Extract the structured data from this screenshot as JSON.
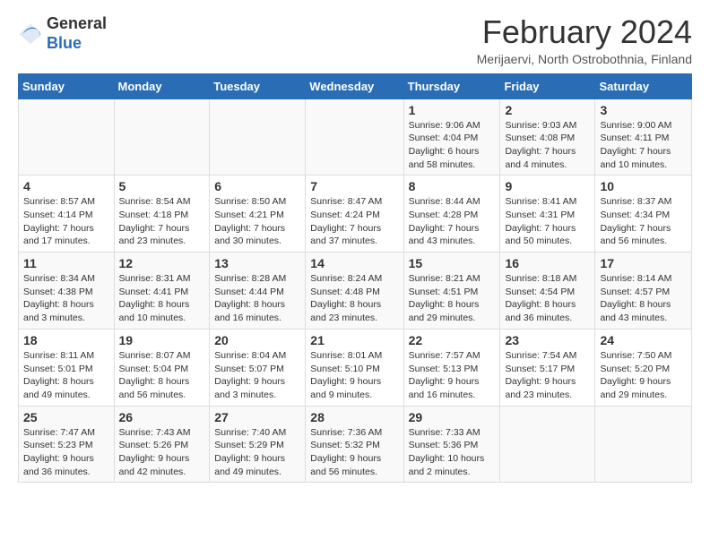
{
  "header": {
    "logo_general": "General",
    "logo_blue": "Blue",
    "month_title": "February 2024",
    "location": "Merijaervi, North Ostrobothnia, Finland"
  },
  "weekdays": [
    "Sunday",
    "Monday",
    "Tuesday",
    "Wednesday",
    "Thursday",
    "Friday",
    "Saturday"
  ],
  "weeks": [
    [
      {
        "day": "",
        "info": ""
      },
      {
        "day": "",
        "info": ""
      },
      {
        "day": "",
        "info": ""
      },
      {
        "day": "",
        "info": ""
      },
      {
        "day": "1",
        "info": "Sunrise: 9:06 AM\nSunset: 4:04 PM\nDaylight: 6 hours\nand 58 minutes."
      },
      {
        "day": "2",
        "info": "Sunrise: 9:03 AM\nSunset: 4:08 PM\nDaylight: 7 hours\nand 4 minutes."
      },
      {
        "day": "3",
        "info": "Sunrise: 9:00 AM\nSunset: 4:11 PM\nDaylight: 7 hours\nand 10 minutes."
      }
    ],
    [
      {
        "day": "4",
        "info": "Sunrise: 8:57 AM\nSunset: 4:14 PM\nDaylight: 7 hours\nand 17 minutes."
      },
      {
        "day": "5",
        "info": "Sunrise: 8:54 AM\nSunset: 4:18 PM\nDaylight: 7 hours\nand 23 minutes."
      },
      {
        "day": "6",
        "info": "Sunrise: 8:50 AM\nSunset: 4:21 PM\nDaylight: 7 hours\nand 30 minutes."
      },
      {
        "day": "7",
        "info": "Sunrise: 8:47 AM\nSunset: 4:24 PM\nDaylight: 7 hours\nand 37 minutes."
      },
      {
        "day": "8",
        "info": "Sunrise: 8:44 AM\nSunset: 4:28 PM\nDaylight: 7 hours\nand 43 minutes."
      },
      {
        "day": "9",
        "info": "Sunrise: 8:41 AM\nSunset: 4:31 PM\nDaylight: 7 hours\nand 50 minutes."
      },
      {
        "day": "10",
        "info": "Sunrise: 8:37 AM\nSunset: 4:34 PM\nDaylight: 7 hours\nand 56 minutes."
      }
    ],
    [
      {
        "day": "11",
        "info": "Sunrise: 8:34 AM\nSunset: 4:38 PM\nDaylight: 8 hours\nand 3 minutes."
      },
      {
        "day": "12",
        "info": "Sunrise: 8:31 AM\nSunset: 4:41 PM\nDaylight: 8 hours\nand 10 minutes."
      },
      {
        "day": "13",
        "info": "Sunrise: 8:28 AM\nSunset: 4:44 PM\nDaylight: 8 hours\nand 16 minutes."
      },
      {
        "day": "14",
        "info": "Sunrise: 8:24 AM\nSunset: 4:48 PM\nDaylight: 8 hours\nand 23 minutes."
      },
      {
        "day": "15",
        "info": "Sunrise: 8:21 AM\nSunset: 4:51 PM\nDaylight: 8 hours\nand 29 minutes."
      },
      {
        "day": "16",
        "info": "Sunrise: 8:18 AM\nSunset: 4:54 PM\nDaylight: 8 hours\nand 36 minutes."
      },
      {
        "day": "17",
        "info": "Sunrise: 8:14 AM\nSunset: 4:57 PM\nDaylight: 8 hours\nand 43 minutes."
      }
    ],
    [
      {
        "day": "18",
        "info": "Sunrise: 8:11 AM\nSunset: 5:01 PM\nDaylight: 8 hours\nand 49 minutes."
      },
      {
        "day": "19",
        "info": "Sunrise: 8:07 AM\nSunset: 5:04 PM\nDaylight: 8 hours\nand 56 minutes."
      },
      {
        "day": "20",
        "info": "Sunrise: 8:04 AM\nSunset: 5:07 PM\nDaylight: 9 hours\nand 3 minutes."
      },
      {
        "day": "21",
        "info": "Sunrise: 8:01 AM\nSunset: 5:10 PM\nDaylight: 9 hours\nand 9 minutes."
      },
      {
        "day": "22",
        "info": "Sunrise: 7:57 AM\nSunset: 5:13 PM\nDaylight: 9 hours\nand 16 minutes."
      },
      {
        "day": "23",
        "info": "Sunrise: 7:54 AM\nSunset: 5:17 PM\nDaylight: 9 hours\nand 23 minutes."
      },
      {
        "day": "24",
        "info": "Sunrise: 7:50 AM\nSunset: 5:20 PM\nDaylight: 9 hours\nand 29 minutes."
      }
    ],
    [
      {
        "day": "25",
        "info": "Sunrise: 7:47 AM\nSunset: 5:23 PM\nDaylight: 9 hours\nand 36 minutes."
      },
      {
        "day": "26",
        "info": "Sunrise: 7:43 AM\nSunset: 5:26 PM\nDaylight: 9 hours\nand 42 minutes."
      },
      {
        "day": "27",
        "info": "Sunrise: 7:40 AM\nSunset: 5:29 PM\nDaylight: 9 hours\nand 49 minutes."
      },
      {
        "day": "28",
        "info": "Sunrise: 7:36 AM\nSunset: 5:32 PM\nDaylight: 9 hours\nand 56 minutes."
      },
      {
        "day": "29",
        "info": "Sunrise: 7:33 AM\nSunset: 5:36 PM\nDaylight: 10 hours\nand 2 minutes."
      },
      {
        "day": "",
        "info": ""
      },
      {
        "day": "",
        "info": ""
      }
    ]
  ]
}
